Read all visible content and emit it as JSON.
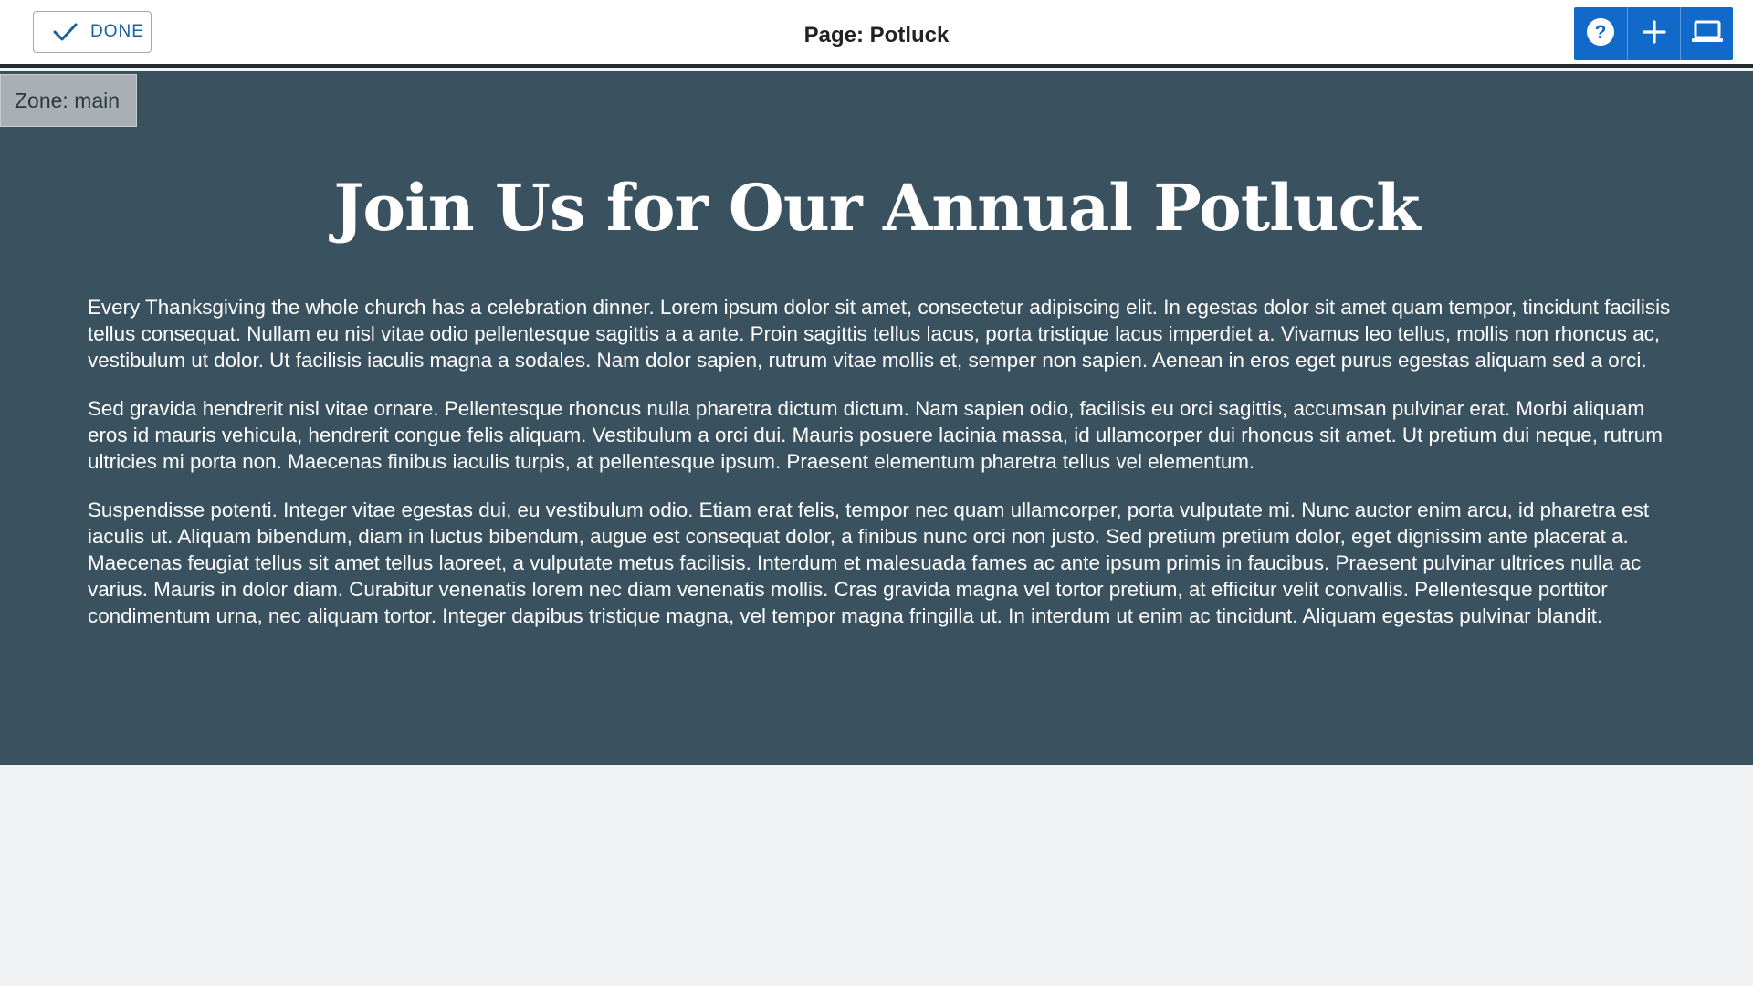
{
  "toolbar": {
    "done_label": "DONE",
    "page_title": "Page: Potluck",
    "buttons": [
      {
        "icon": "help-icon"
      },
      {
        "icon": "plus-icon"
      },
      {
        "icon": "laptop-icon"
      }
    ],
    "accent_color": "#1169c9"
  },
  "zone": {
    "label": "Zone: main",
    "background": "#3a515f"
  },
  "content": {
    "heading": "Join Us for Our Annual Potluck",
    "paragraphs": [
      "Every Thanksgiving the whole church has a celebration dinner. Lorem ipsum dolor sit amet, consectetur adipiscing elit. In egestas dolor sit amet quam tempor, tincidunt facilisis tellus consequat. Nullam eu nisl vitae odio pellentesque sagittis a a ante. Proin sagittis tellus lacus, porta tristique lacus imperdiet a. Vivamus leo tellus, mollis non rhoncus ac, vestibulum ut dolor. Ut facilisis iaculis magna a sodales. Nam dolor sapien, rutrum vitae mollis et, semper non sapien. Aenean in eros eget purus egestas aliquam sed a orci.",
      "Sed gravida hendrerit nisl vitae ornare. Pellentesque rhoncus nulla pharetra dictum dictum. Nam sapien odio, facilisis eu orci sagittis, accumsan pulvinar erat. Morbi aliquam eros id mauris vehicula, hendrerit congue felis aliquam. Vestibulum a orci dui. Mauris posuere lacinia massa, id ullamcorper dui rhoncus sit amet. Ut pretium dui neque, rutrum ultricies mi porta non. Maecenas finibus iaculis turpis, at pellentesque ipsum. Praesent elementum pharetra tellus vel elementum.",
      "Suspendisse potenti. Integer vitae egestas dui, eu vestibulum odio. Etiam erat felis, tempor nec quam ullamcorper, porta vulputate mi. Nunc auctor enim arcu, id pharetra est iaculis ut. Aliquam bibendum, diam in luctus bibendum, augue est consequat dolor, a finibus nunc orci non justo. Sed pretium pretium dolor, eget dignissim ante placerat a. Maecenas feugiat tellus sit amet tellus laoreet, a vulputate metus facilisis. Interdum et malesuada fames ac ante ipsum primis in faucibus. Praesent pulvinar ultrices nulla ac varius. Mauris in dolor diam. Curabitur venenatis lorem nec diam venenatis mollis. Cras gravida magna vel tortor pretium, at efficitur velit convallis. Pellentesque porttitor condimentum urna, nec aliquam tortor. Integer dapibus tristique magna, vel tempor magna fringilla ut. In interdum ut enim ac tincidunt. Aliquam egestas pulvinar blandit."
    ]
  }
}
